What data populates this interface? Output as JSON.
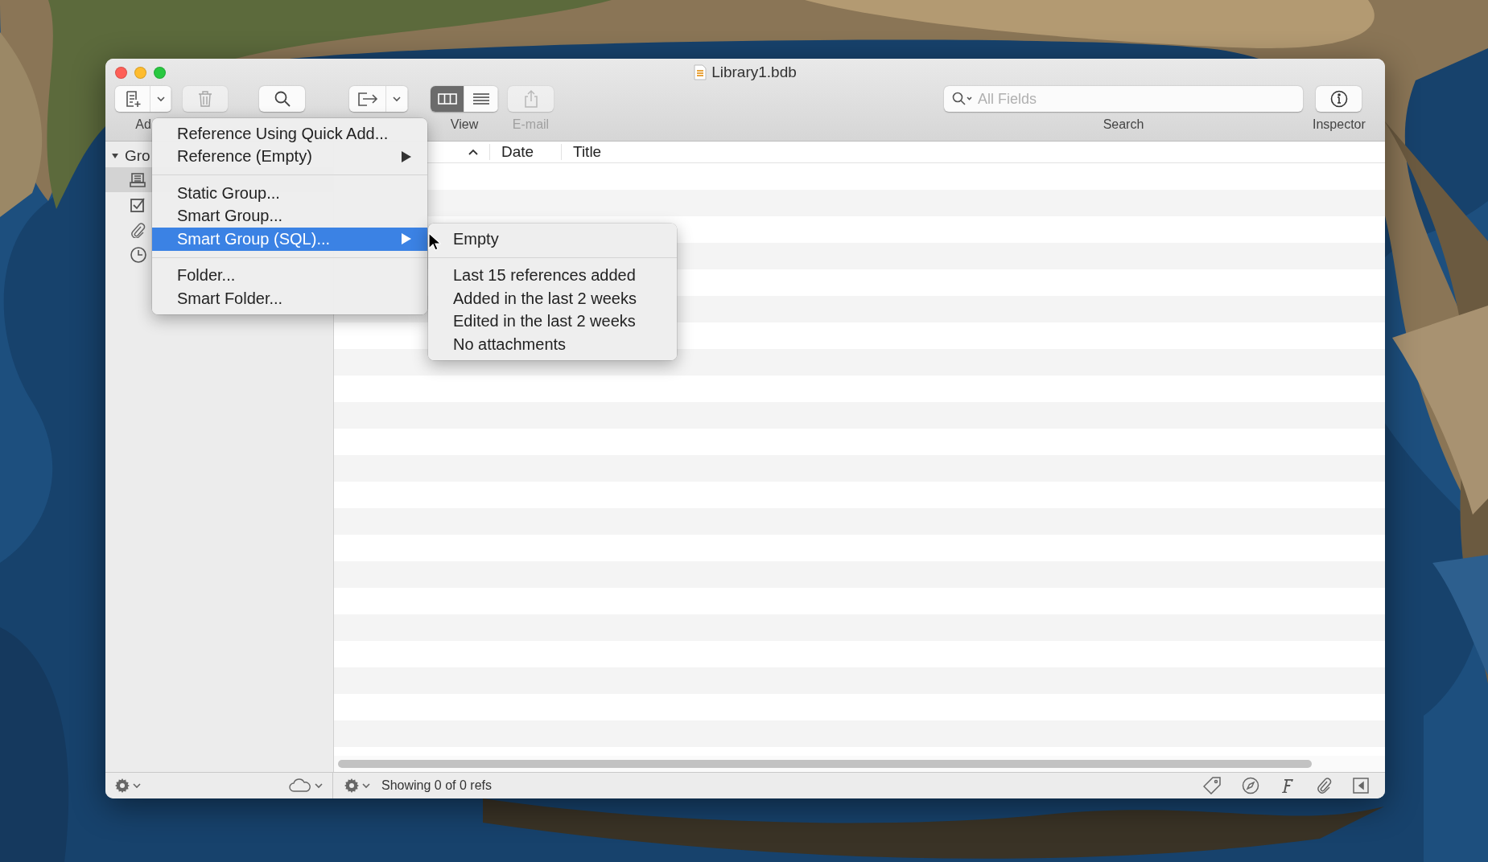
{
  "window": {
    "title": "Library1.bdb"
  },
  "toolbar": {
    "items": [
      {
        "kind": "add",
        "label": "Ad"
      },
      {
        "kind": "trash",
        "disabled": true
      },
      {
        "kind": "search"
      },
      {
        "kind": "export"
      },
      {
        "kind": "view",
        "label": "View",
        "segments": [
          {
            "kind": "columns",
            "selected": true
          },
          {
            "kind": "list",
            "selected": false
          }
        ]
      },
      {
        "kind": "email",
        "label": "E-mail",
        "disabled": true
      }
    ],
    "search": {
      "placeholder": "All Fields",
      "label": "Search"
    },
    "inspector": {
      "label": "Inspector"
    }
  },
  "sidebar": {
    "header": "Gro",
    "items": [
      {
        "kind": "library",
        "selected": true
      },
      {
        "kind": "checked",
        "selected": false
      },
      {
        "kind": "attachments",
        "selected": false
      },
      {
        "kind": "recent",
        "selected": false
      }
    ]
  },
  "table": {
    "columns": [
      {
        "sort_ascending": true
      },
      {
        "label": "Date"
      },
      {
        "label": "Title"
      }
    ]
  },
  "add_menu": {
    "items": [
      {
        "kind": "item",
        "label": "Reference Using Quick Add...",
        "submenu": false,
        "selected": false
      },
      {
        "kind": "item",
        "label": "Reference (Empty)",
        "submenu": true,
        "selected": false
      },
      {
        "kind": "separator"
      },
      {
        "kind": "item",
        "label": "Static Group...",
        "submenu": false,
        "selected": false
      },
      {
        "kind": "item",
        "label": "Smart Group...",
        "submenu": false,
        "selected": false
      },
      {
        "kind": "item",
        "label": "Smart Group (SQL)...",
        "submenu": true,
        "selected": true
      },
      {
        "kind": "separator"
      },
      {
        "kind": "item",
        "label": "Folder...",
        "submenu": false,
        "selected": false
      },
      {
        "kind": "item",
        "label": "Smart Folder...",
        "submenu": false,
        "selected": false
      }
    ]
  },
  "submenu": {
    "items": [
      {
        "kind": "item",
        "label": "Empty"
      },
      {
        "kind": "separator"
      },
      {
        "kind": "item",
        "label": "Last 15 references added"
      },
      {
        "kind": "item",
        "label": "Added in the last 2 weeks"
      },
      {
        "kind": "item",
        "label": "Edited in the last 2 weeks"
      },
      {
        "kind": "item",
        "label": "No attachments"
      }
    ]
  },
  "status_bar": {
    "text": "Showing 0 of 0 refs"
  }
}
